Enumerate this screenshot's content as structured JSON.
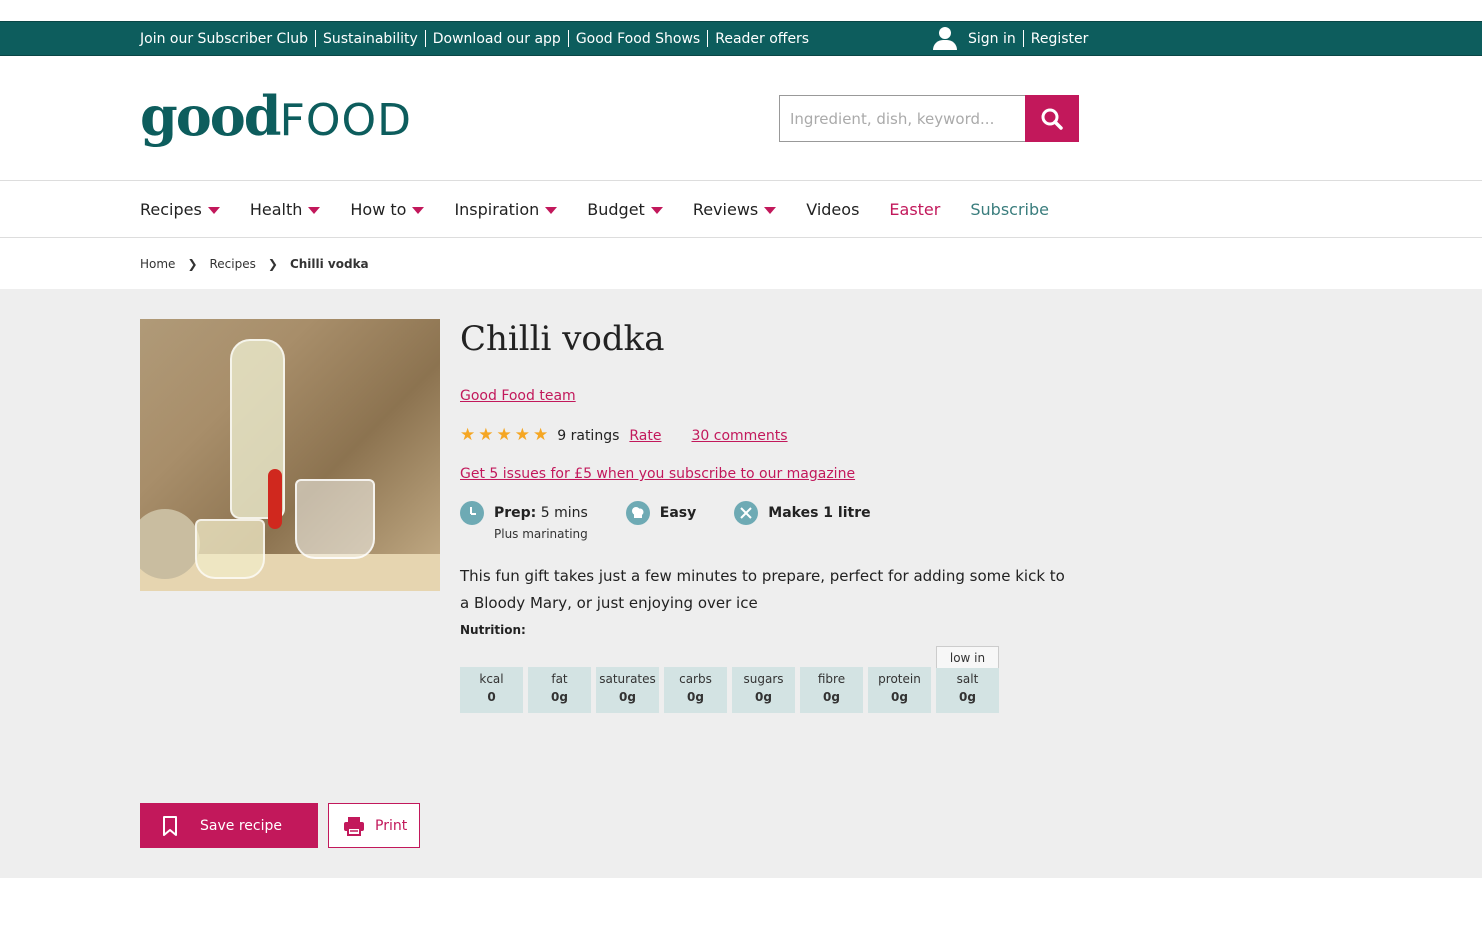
{
  "topbar": {
    "links": [
      "Join our Subscriber Club",
      "Sustainability",
      "Download our app",
      "Good Food Shows",
      "Reader offers"
    ],
    "sign_in": "Sign in",
    "register": "Register"
  },
  "header": {
    "logo_good": "good",
    "logo_food": "FOOD",
    "search_placeholder": "Ingredient, dish, keyword..."
  },
  "nav": {
    "items": [
      {
        "label": "Recipes",
        "dropdown": true
      },
      {
        "label": "Health",
        "dropdown": true
      },
      {
        "label": "How to",
        "dropdown": true
      },
      {
        "label": "Inspiration",
        "dropdown": true
      },
      {
        "label": "Budget",
        "dropdown": true
      },
      {
        "label": "Reviews",
        "dropdown": true
      },
      {
        "label": "Videos",
        "dropdown": false
      },
      {
        "label": "Easter",
        "dropdown": false
      },
      {
        "label": "Subscribe",
        "dropdown": false
      }
    ]
  },
  "breadcrumb": {
    "home": "Home",
    "recipes": "Recipes",
    "current": "Chilli vodka"
  },
  "recipe": {
    "title": "Chilli vodka",
    "author": "Good Food team",
    "rating_stars": 5,
    "ratings_count": "9 ratings",
    "rate_label": "Rate",
    "comments": "30 comments",
    "promo": "Get 5 issues for £5 when you subscribe to our magazine",
    "prep_label": "Prep:",
    "prep_value": "5 mins",
    "prep_note": "Plus marinating",
    "difficulty": "Easy",
    "makes": "Makes 1 litre",
    "description": "This fun gift takes just a few minutes to prepare, perfect for adding some kick to a Bloody Mary, or just enjoying over ice",
    "nutrition_label": "Nutrition:"
  },
  "nutrition": [
    {
      "name": "kcal",
      "value": "0"
    },
    {
      "name": "fat",
      "value": "0g"
    },
    {
      "name": "saturates",
      "value": "0g"
    },
    {
      "name": "carbs",
      "value": "0g"
    },
    {
      "name": "sugars",
      "value": "0g"
    },
    {
      "name": "fibre",
      "value": "0g"
    },
    {
      "name": "protein",
      "value": "0g"
    },
    {
      "name": "salt",
      "value": "0g",
      "tag": "low in"
    }
  ],
  "actions": {
    "save": "Save recipe",
    "print": "Print"
  },
  "colors": {
    "teal": "#0d5d5d",
    "magenta": "#c2185b",
    "star": "#f5a623",
    "nutrition_bg": "#d3e3e3"
  }
}
